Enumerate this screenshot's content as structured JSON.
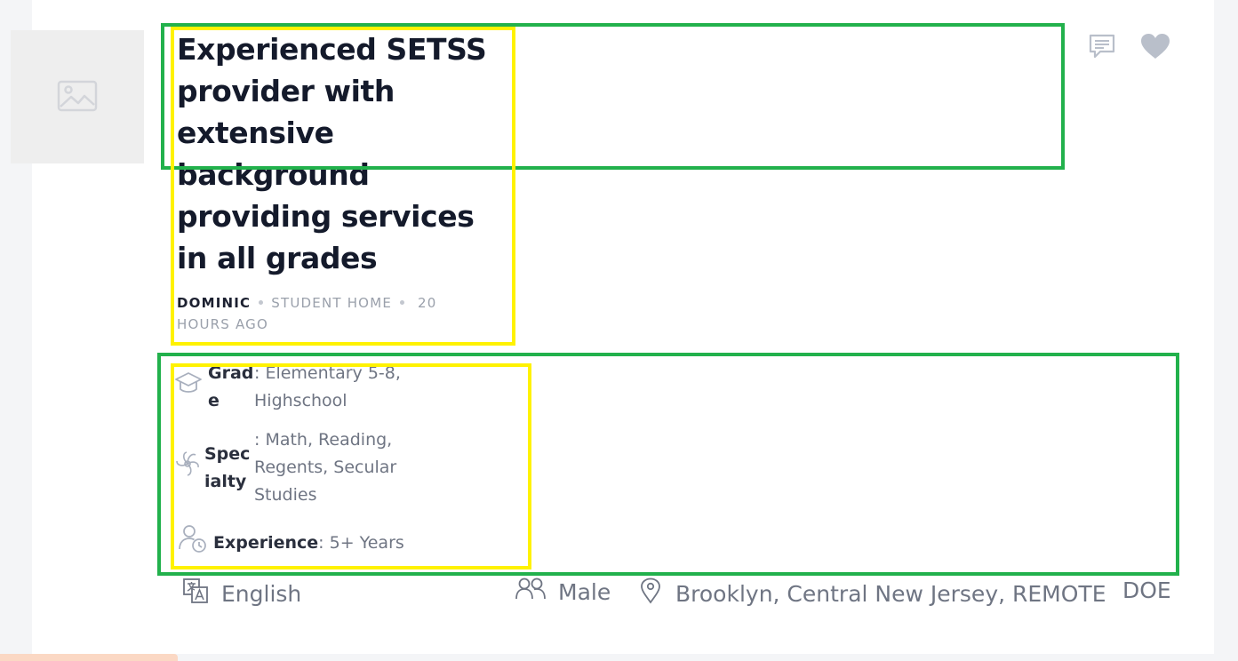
{
  "listing": {
    "title": "Experienced SETSS provider with extensive background providing services in all grades",
    "author": "DOMINIC",
    "category": "STUDENT HOME",
    "posted": "20 HOURS AGO"
  },
  "attributes": {
    "grade_label": "Grade",
    "grade_value": ": Elementary 5-8, Highschool",
    "specialty_label": "Specialty",
    "specialty_value": ": Math, Reading, Regents, Secular Studies",
    "experience_label": "Experience",
    "experience_value": ": 5+ Years"
  },
  "footer": {
    "language": "English",
    "gender": "Male",
    "location": "Brooklyn, Central New Jersey, REMOTE",
    "org": "DOE"
  },
  "icons": {
    "thumbnail": "image-placeholder-icon",
    "comment": "comment-icon",
    "favorite": "heart-icon",
    "grade": "graduation-cap-icon",
    "specialty": "specialty-swirl-icon",
    "experience": "user-clock-icon",
    "language": "translate-icon",
    "gender": "users-icon",
    "location": "location-pin-icon"
  },
  "colors": {
    "title": "#141a2b",
    "muted": "#6f7583",
    "annotation_green": "#22b14c",
    "annotation_yellow": "#fff200",
    "heart": "#b9bfca"
  }
}
